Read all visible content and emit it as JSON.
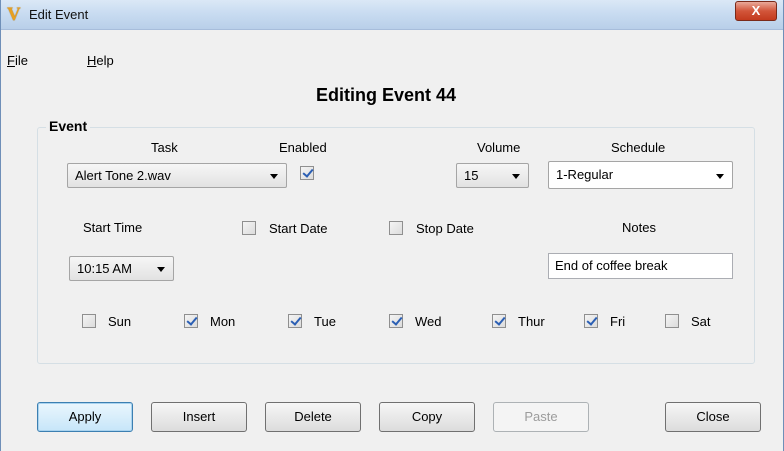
{
  "window": {
    "title": "Edit Event",
    "close_glyph": "X",
    "app_icon_glyph": "V"
  },
  "menu": {
    "file": "File",
    "file_mnemonic": "F",
    "file_rest": "ile",
    "help": "Help",
    "help_mnemonic": "H",
    "help_rest": "elp"
  },
  "heading": "Editing Event 44",
  "group": {
    "title": "Event",
    "task_label": "Task",
    "task_value": "Alert Tone 2.wav",
    "enabled_label": "Enabled",
    "enabled_checked": true,
    "volume_label": "Volume",
    "volume_value": "15",
    "schedule_label": "Schedule",
    "schedule_value": "1-Regular",
    "start_time_label": "Start Time",
    "start_time_value": "10:15 AM",
    "start_date_label": "Start Date",
    "start_date_checked": false,
    "stop_date_label": "Stop Date",
    "stop_date_checked": false,
    "notes_label": "Notes",
    "notes_value": "End of coffee break",
    "days": [
      {
        "label": "Sun",
        "checked": false
      },
      {
        "label": "Mon",
        "checked": true
      },
      {
        "label": "Tue",
        "checked": true
      },
      {
        "label": "Wed",
        "checked": true
      },
      {
        "label": "Thur",
        "checked": true
      },
      {
        "label": "Fri",
        "checked": true
      },
      {
        "label": "Sat",
        "checked": false
      }
    ]
  },
  "buttons": {
    "apply": "Apply",
    "insert": "Insert",
    "delete": "Delete",
    "copy": "Copy",
    "paste": "Paste",
    "close": "Close"
  },
  "colors": {
    "accent": "#3c7fb1",
    "titlebar": "#c9dcf1",
    "close_button": "#d2553a"
  }
}
